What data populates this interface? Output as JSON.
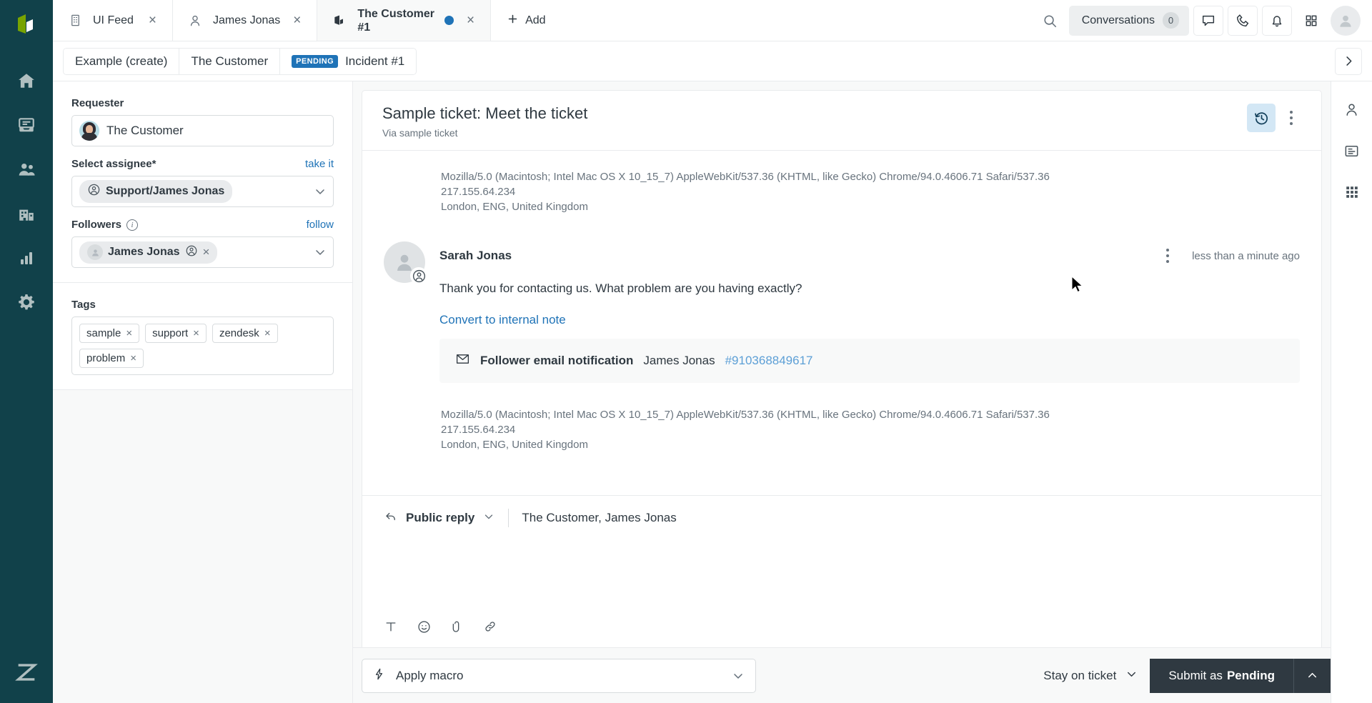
{
  "brand": {
    "accent": "#1f73b7",
    "rail_bg": "#11414a",
    "dark_button": "#2f3941"
  },
  "tabs": [
    {
      "label": "UI Feed",
      "icon": "building-icon",
      "active": false,
      "close": "×"
    },
    {
      "label": "James Jonas",
      "icon": "user-icon",
      "active": false,
      "close": "×"
    },
    {
      "label": "The Customer\n#1",
      "icon": "ticket-icon",
      "active": true,
      "close": "×",
      "dot": true
    }
  ],
  "topbar": {
    "add_label": "Add",
    "add_icon": "plus-icon",
    "search_icon": "search-icon",
    "conversations_label": "Conversations",
    "conversations_count": "0",
    "chat_icon": "chat-bubble-icon",
    "phone_icon": "phone-icon",
    "bell_icon": "bell-icon",
    "apps_icon": "grid-apps-icon",
    "avatar_icon": "user-avatar-icon"
  },
  "breadcrumb": {
    "items": [
      {
        "label": "Example (create)"
      },
      {
        "label": "The Customer"
      },
      {
        "label": "Incident #1",
        "badge": "PENDING"
      }
    ],
    "next_icon": "chevron-right-icon"
  },
  "sidebar": {
    "logo": "zendesk-logo",
    "items": [
      {
        "name": "home",
        "icon": "home-icon"
      },
      {
        "name": "views",
        "icon": "views-icon"
      },
      {
        "name": "customers",
        "icon": "customers-icon"
      },
      {
        "name": "organizations",
        "icon": "organizations-icon"
      },
      {
        "name": "reporting",
        "icon": "bar-chart-icon"
      },
      {
        "name": "settings",
        "icon": "gear-icon"
      }
    ],
    "bottom_icon": "zendesk-z-icon"
  },
  "properties": {
    "requester": {
      "label": "Requester",
      "value": "The Customer",
      "avatar": "customer-photo-avatar"
    },
    "assignee": {
      "label": "Select assignee*",
      "action_label": "take it",
      "value": "Support/James Jonas",
      "icon": "agent-icon",
      "caret": "chevron-down-icon"
    },
    "followers": {
      "label": "Followers",
      "info_icon": "info-icon",
      "action_label": "follow",
      "value": "James Jonas",
      "badge_icon": "agent-icon",
      "remove_icon": "close-icon",
      "caret": "chevron-down-icon"
    },
    "tags": {
      "label": "Tags",
      "items": [
        "sample",
        "support",
        "zendesk",
        "problem"
      ],
      "remove_icon": "close-icon"
    }
  },
  "ticket": {
    "title": "Sample ticket: Meet the ticket",
    "subtitle": "Via sample ticket",
    "history_icon": "history-clock-icon",
    "more_icon": "kebab-menu-icon",
    "meta_top": [
      "Mozilla/5.0 (Macintosh; Intel Mac OS X 10_15_7) AppleWebKit/537.36 (KHTML, like Gecko) Chrome/94.0.4606.71 Safari/537.36",
      "217.155.64.234",
      "London, ENG, United Kingdom"
    ],
    "comment": {
      "author": "Sarah Jonas",
      "avatar_icon": "user-avatar-icon",
      "badge_icon": "agent-icon",
      "more_icon": "kebab-menu-icon",
      "timestamp": "less than a minute ago",
      "text": "Thank you for contacting us. What problem are you having exactly?",
      "convert_link": "Convert to internal note",
      "notification": {
        "icon": "envelope-icon",
        "title": "Follower email notification",
        "recipient": "James Jonas",
        "id": "#910368849617"
      }
    },
    "meta_bottom": [
      "Mozilla/5.0 (Macintosh; Intel Mac OS X 10_15_7) AppleWebKit/537.36 (KHTML, like Gecko) Chrome/94.0.4606.71 Safari/537.36",
      "217.155.64.234",
      "London, ENG, United Kingdom"
    ]
  },
  "composer": {
    "channel_label": "Public reply",
    "channel_icon": "reply-arrow-icon",
    "channel_caret": "chevron-down-icon",
    "recipients": "The Customer, James Jonas",
    "placeholder": "",
    "value": "",
    "tools": [
      {
        "name": "text-format-icon",
        "glyph": "T"
      },
      {
        "name": "emoji-icon",
        "glyph": "☺"
      },
      {
        "name": "attachment-icon",
        "glyph": "📎"
      },
      {
        "name": "link-icon",
        "glyph": "🔗"
      }
    ]
  },
  "footer": {
    "macro_label": "Apply macro",
    "macro_icon": "macro-bolt-icon",
    "macro_caret": "chevron-down-icon",
    "stay_label": "Stay on ticket",
    "stay_caret": "chevron-down-icon",
    "submit_prefix": "Submit as",
    "submit_status": "Pending",
    "submit_caret": "chevron-up-icon"
  },
  "right_rail": {
    "items": [
      {
        "name": "user-panel-icon"
      },
      {
        "name": "organization-panel-icon"
      },
      {
        "name": "apps-panel-icon"
      }
    ]
  }
}
